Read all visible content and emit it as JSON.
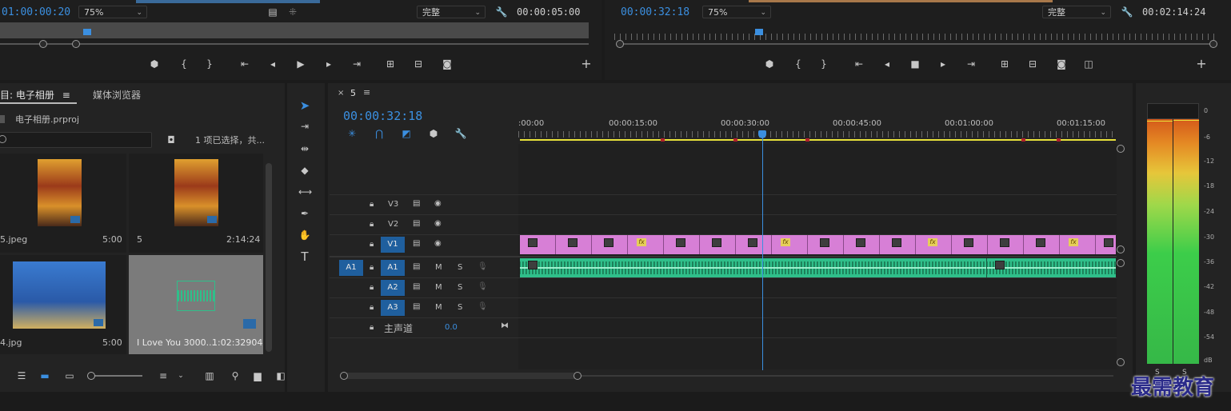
{
  "source_monitor": {
    "timecode": "01:00:00:20",
    "zoom": "75%",
    "quality": "完整",
    "duration": "00:00:05:00"
  },
  "program_monitor": {
    "timecode": "00:00:32:18",
    "zoom": "75%",
    "quality": "完整",
    "duration": "00:02:14:24"
  },
  "project_panel": {
    "tab_project": "目: 电子相册",
    "tab_media_browser": "媒体浏览器",
    "project_file": "电子相册.prproj",
    "selection_status": "1 项已选择，共...",
    "items": [
      {
        "name": "5.jpeg",
        "duration": "5:00",
        "kind": "image"
      },
      {
        "name": "5",
        "duration": "2:14:24",
        "kind": "sequence"
      },
      {
        "name": "4.jpg",
        "duration": "5:00",
        "kind": "image"
      },
      {
        "name": "I Love You 3000...",
        "duration": "1:02:32904",
        "kind": "audio"
      }
    ]
  },
  "timeline": {
    "sequence_tab": "5",
    "close_glyph": "×",
    "timecode": "00:00:32:18",
    "ruler_labels": [
      ":00:00",
      "00:00:15:00",
      "00:00:30:00",
      "00:00:45:00",
      "00:01:00:00",
      "00:01:15:00"
    ],
    "tracks": {
      "v3": "V3",
      "v2": "V2",
      "v1": "V1",
      "a1_source": "A1",
      "a1": "A1",
      "a2": "A2",
      "a3": "A3",
      "mute": "M",
      "solo": "S",
      "master": "主声道",
      "master_value": "0.0"
    },
    "fx_label": "fx"
  },
  "audio_meter": {
    "scale": [
      "0",
      "-6",
      "-12",
      "-18",
      "-24",
      "-30",
      "-36",
      "-42",
      "-48",
      "-54",
      "dB"
    ],
    "solo_labels": [
      "S",
      "S"
    ]
  },
  "watermark": "最需教育",
  "colors": {
    "accent_blue": "#3b8fe0",
    "video_clip": "#d77fd6",
    "audio_clip": "#2fbf8a",
    "playhead": "#3b8fe0",
    "work_area": "#e8e23a"
  }
}
